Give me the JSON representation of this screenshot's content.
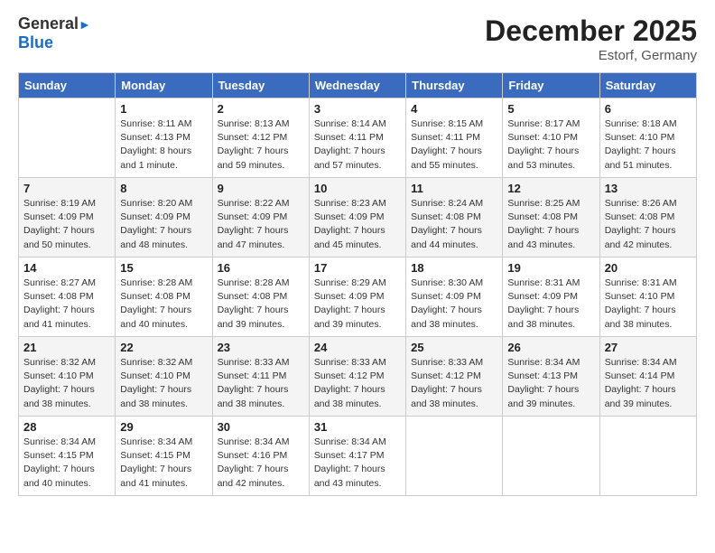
{
  "header": {
    "logo_line1": "General",
    "logo_line2": "Blue",
    "month": "December 2025",
    "location": "Estorf, Germany"
  },
  "columns": [
    "Sunday",
    "Monday",
    "Tuesday",
    "Wednesday",
    "Thursday",
    "Friday",
    "Saturday"
  ],
  "weeks": [
    [
      {
        "day": "",
        "info": ""
      },
      {
        "day": "1",
        "info": "Sunrise: 8:11 AM\nSunset: 4:13 PM\nDaylight: 8 hours\nand 1 minute."
      },
      {
        "day": "2",
        "info": "Sunrise: 8:13 AM\nSunset: 4:12 PM\nDaylight: 7 hours\nand 59 minutes."
      },
      {
        "day": "3",
        "info": "Sunrise: 8:14 AM\nSunset: 4:11 PM\nDaylight: 7 hours\nand 57 minutes."
      },
      {
        "day": "4",
        "info": "Sunrise: 8:15 AM\nSunset: 4:11 PM\nDaylight: 7 hours\nand 55 minutes."
      },
      {
        "day": "5",
        "info": "Sunrise: 8:17 AM\nSunset: 4:10 PM\nDaylight: 7 hours\nand 53 minutes."
      },
      {
        "day": "6",
        "info": "Sunrise: 8:18 AM\nSunset: 4:10 PM\nDaylight: 7 hours\nand 51 minutes."
      }
    ],
    [
      {
        "day": "7",
        "info": "Sunrise: 8:19 AM\nSunset: 4:09 PM\nDaylight: 7 hours\nand 50 minutes."
      },
      {
        "day": "8",
        "info": "Sunrise: 8:20 AM\nSunset: 4:09 PM\nDaylight: 7 hours\nand 48 minutes."
      },
      {
        "day": "9",
        "info": "Sunrise: 8:22 AM\nSunset: 4:09 PM\nDaylight: 7 hours\nand 47 minutes."
      },
      {
        "day": "10",
        "info": "Sunrise: 8:23 AM\nSunset: 4:09 PM\nDaylight: 7 hours\nand 45 minutes."
      },
      {
        "day": "11",
        "info": "Sunrise: 8:24 AM\nSunset: 4:08 PM\nDaylight: 7 hours\nand 44 minutes."
      },
      {
        "day": "12",
        "info": "Sunrise: 8:25 AM\nSunset: 4:08 PM\nDaylight: 7 hours\nand 43 minutes."
      },
      {
        "day": "13",
        "info": "Sunrise: 8:26 AM\nSunset: 4:08 PM\nDaylight: 7 hours\nand 42 minutes."
      }
    ],
    [
      {
        "day": "14",
        "info": "Sunrise: 8:27 AM\nSunset: 4:08 PM\nDaylight: 7 hours\nand 41 minutes."
      },
      {
        "day": "15",
        "info": "Sunrise: 8:28 AM\nSunset: 4:08 PM\nDaylight: 7 hours\nand 40 minutes."
      },
      {
        "day": "16",
        "info": "Sunrise: 8:28 AM\nSunset: 4:08 PM\nDaylight: 7 hours\nand 39 minutes."
      },
      {
        "day": "17",
        "info": "Sunrise: 8:29 AM\nSunset: 4:09 PM\nDaylight: 7 hours\nand 39 minutes."
      },
      {
        "day": "18",
        "info": "Sunrise: 8:30 AM\nSunset: 4:09 PM\nDaylight: 7 hours\nand 38 minutes."
      },
      {
        "day": "19",
        "info": "Sunrise: 8:31 AM\nSunset: 4:09 PM\nDaylight: 7 hours\nand 38 minutes."
      },
      {
        "day": "20",
        "info": "Sunrise: 8:31 AM\nSunset: 4:10 PM\nDaylight: 7 hours\nand 38 minutes."
      }
    ],
    [
      {
        "day": "21",
        "info": "Sunrise: 8:32 AM\nSunset: 4:10 PM\nDaylight: 7 hours\nand 38 minutes."
      },
      {
        "day": "22",
        "info": "Sunrise: 8:32 AM\nSunset: 4:10 PM\nDaylight: 7 hours\nand 38 minutes."
      },
      {
        "day": "23",
        "info": "Sunrise: 8:33 AM\nSunset: 4:11 PM\nDaylight: 7 hours\nand 38 minutes."
      },
      {
        "day": "24",
        "info": "Sunrise: 8:33 AM\nSunset: 4:12 PM\nDaylight: 7 hours\nand 38 minutes."
      },
      {
        "day": "25",
        "info": "Sunrise: 8:33 AM\nSunset: 4:12 PM\nDaylight: 7 hours\nand 38 minutes."
      },
      {
        "day": "26",
        "info": "Sunrise: 8:34 AM\nSunset: 4:13 PM\nDaylight: 7 hours\nand 39 minutes."
      },
      {
        "day": "27",
        "info": "Sunrise: 8:34 AM\nSunset: 4:14 PM\nDaylight: 7 hours\nand 39 minutes."
      }
    ],
    [
      {
        "day": "28",
        "info": "Sunrise: 8:34 AM\nSunset: 4:15 PM\nDaylight: 7 hours\nand 40 minutes."
      },
      {
        "day": "29",
        "info": "Sunrise: 8:34 AM\nSunset: 4:15 PM\nDaylight: 7 hours\nand 41 minutes."
      },
      {
        "day": "30",
        "info": "Sunrise: 8:34 AM\nSunset: 4:16 PM\nDaylight: 7 hours\nand 42 minutes."
      },
      {
        "day": "31",
        "info": "Sunrise: 8:34 AM\nSunset: 4:17 PM\nDaylight: 7 hours\nand 43 minutes."
      },
      {
        "day": "",
        "info": ""
      },
      {
        "day": "",
        "info": ""
      },
      {
        "day": "",
        "info": ""
      }
    ]
  ]
}
